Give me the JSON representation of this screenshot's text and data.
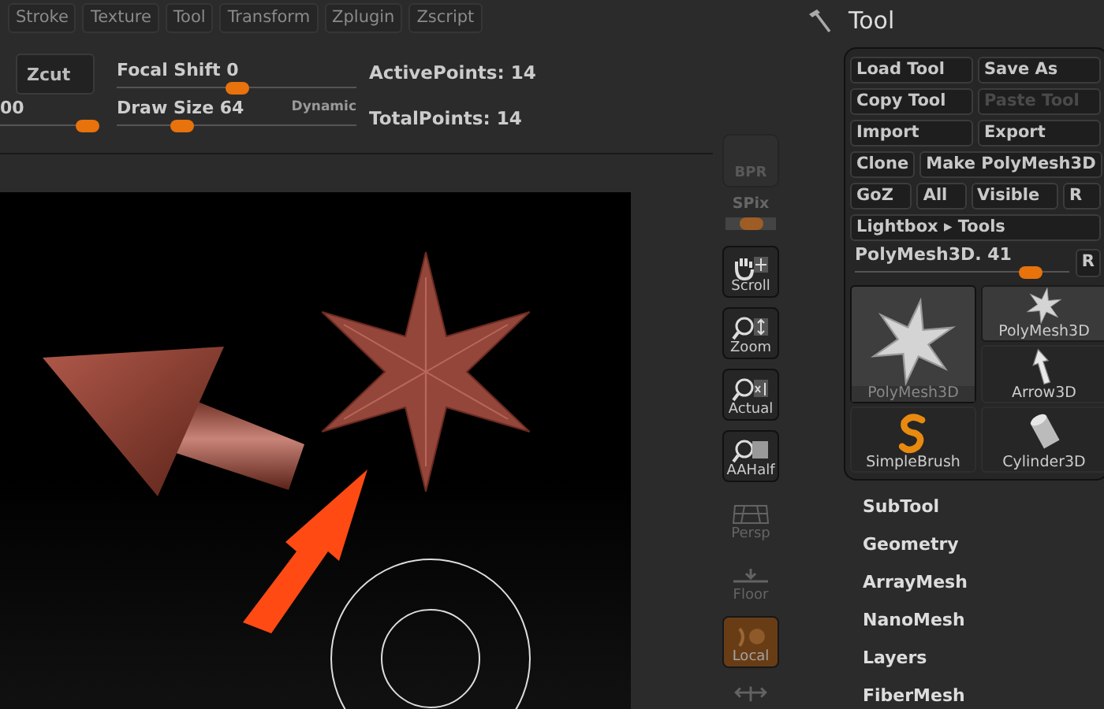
{
  "menu": [
    {
      "label": "Stroke"
    },
    {
      "label": "Texture"
    },
    {
      "label": "Tool"
    },
    {
      "label": "Transform"
    },
    {
      "label": "Zplugin"
    },
    {
      "label": "Zscript"
    }
  ],
  "top_bar": {
    "zcut_button": "Zcut",
    "edge_slider": {
      "reading": "00",
      "level": 0.88
    },
    "focal_shift": {
      "label": "Focal Shift",
      "reading": "0",
      "level": 0.5
    },
    "draw_size": {
      "label": "Draw Size",
      "reading": "64",
      "level": 0.27,
      "mode": "Dynamic"
    },
    "stats": [
      "ActivePoints: 14",
      "TotalPoints: 14"
    ]
  },
  "shelf": {
    "bpr": {
      "label": "BPR",
      "disabled": true
    },
    "spix": {
      "label": "SPix",
      "level": 0.5
    },
    "buttons": [
      {
        "label": "Scroll",
        "kind": "scroll",
        "disabled": false,
        "on": false
      },
      {
        "label": "Zoom",
        "kind": "zoom",
        "disabled": false,
        "on": false
      },
      {
        "label": "Actual",
        "kind": "actual",
        "disabled": false,
        "on": false
      },
      {
        "label": "AAHalf",
        "kind": "aahalf",
        "disabled": false,
        "on": false
      },
      {
        "label": "Persp",
        "kind": "persp",
        "disabled": true,
        "on": false
      },
      {
        "label": "Floor",
        "kind": "floor",
        "disabled": true,
        "on": false
      },
      {
        "label": "Local",
        "kind": "local",
        "disabled": false,
        "on": true
      },
      {
        "kind": "xyz",
        "disabled": true,
        "on": false
      }
    ]
  },
  "tool_panel": {
    "title": "Tool",
    "button_rows": [
      [
        {
          "label": "Load Tool",
          "disabled": false
        },
        {
          "label": "Save As",
          "disabled": false
        }
      ],
      [
        {
          "label": "Copy Tool",
          "disabled": false
        },
        {
          "label": "Paste Tool",
          "disabled": true
        }
      ],
      [
        {
          "label": "Import",
          "disabled": false
        },
        {
          "label": "Export",
          "disabled": false
        }
      ],
      [
        {
          "label": "Clone",
          "disabled": false
        },
        {
          "label": "Make PolyMesh3D",
          "disabled": false
        }
      ],
      [
        {
          "label": "GoZ",
          "disabled": false
        },
        {
          "label": "All",
          "disabled": false
        },
        {
          "label": "Visible",
          "disabled": false
        },
        {
          "label": "R",
          "disabled": false
        }
      ],
      [
        {
          "label": "Lightbox ▸ Tools",
          "disabled": false
        }
      ]
    ],
    "polymesh_slider": {
      "label": "PolyMesh3D. 41",
      "level": 0.82,
      "button": "R"
    },
    "current_tool": {
      "label": "PolyMesh3D",
      "kind": "star"
    },
    "tools": [
      {
        "label": "PolyMesh3D",
        "kind": "star",
        "selected": true
      },
      {
        "label": "Arrow3D",
        "kind": "arrow",
        "selected": false
      },
      {
        "label": "SimpleBrush",
        "kind": "brush",
        "selected": false
      },
      {
        "label": "Cylinder3D",
        "kind": "cylinder",
        "selected": false
      }
    ],
    "subpalettes": [
      "SubTool",
      "Geometry",
      "ArrayMesh",
      "NanoMesh",
      "Layers",
      "FiberMesh"
    ]
  }
}
